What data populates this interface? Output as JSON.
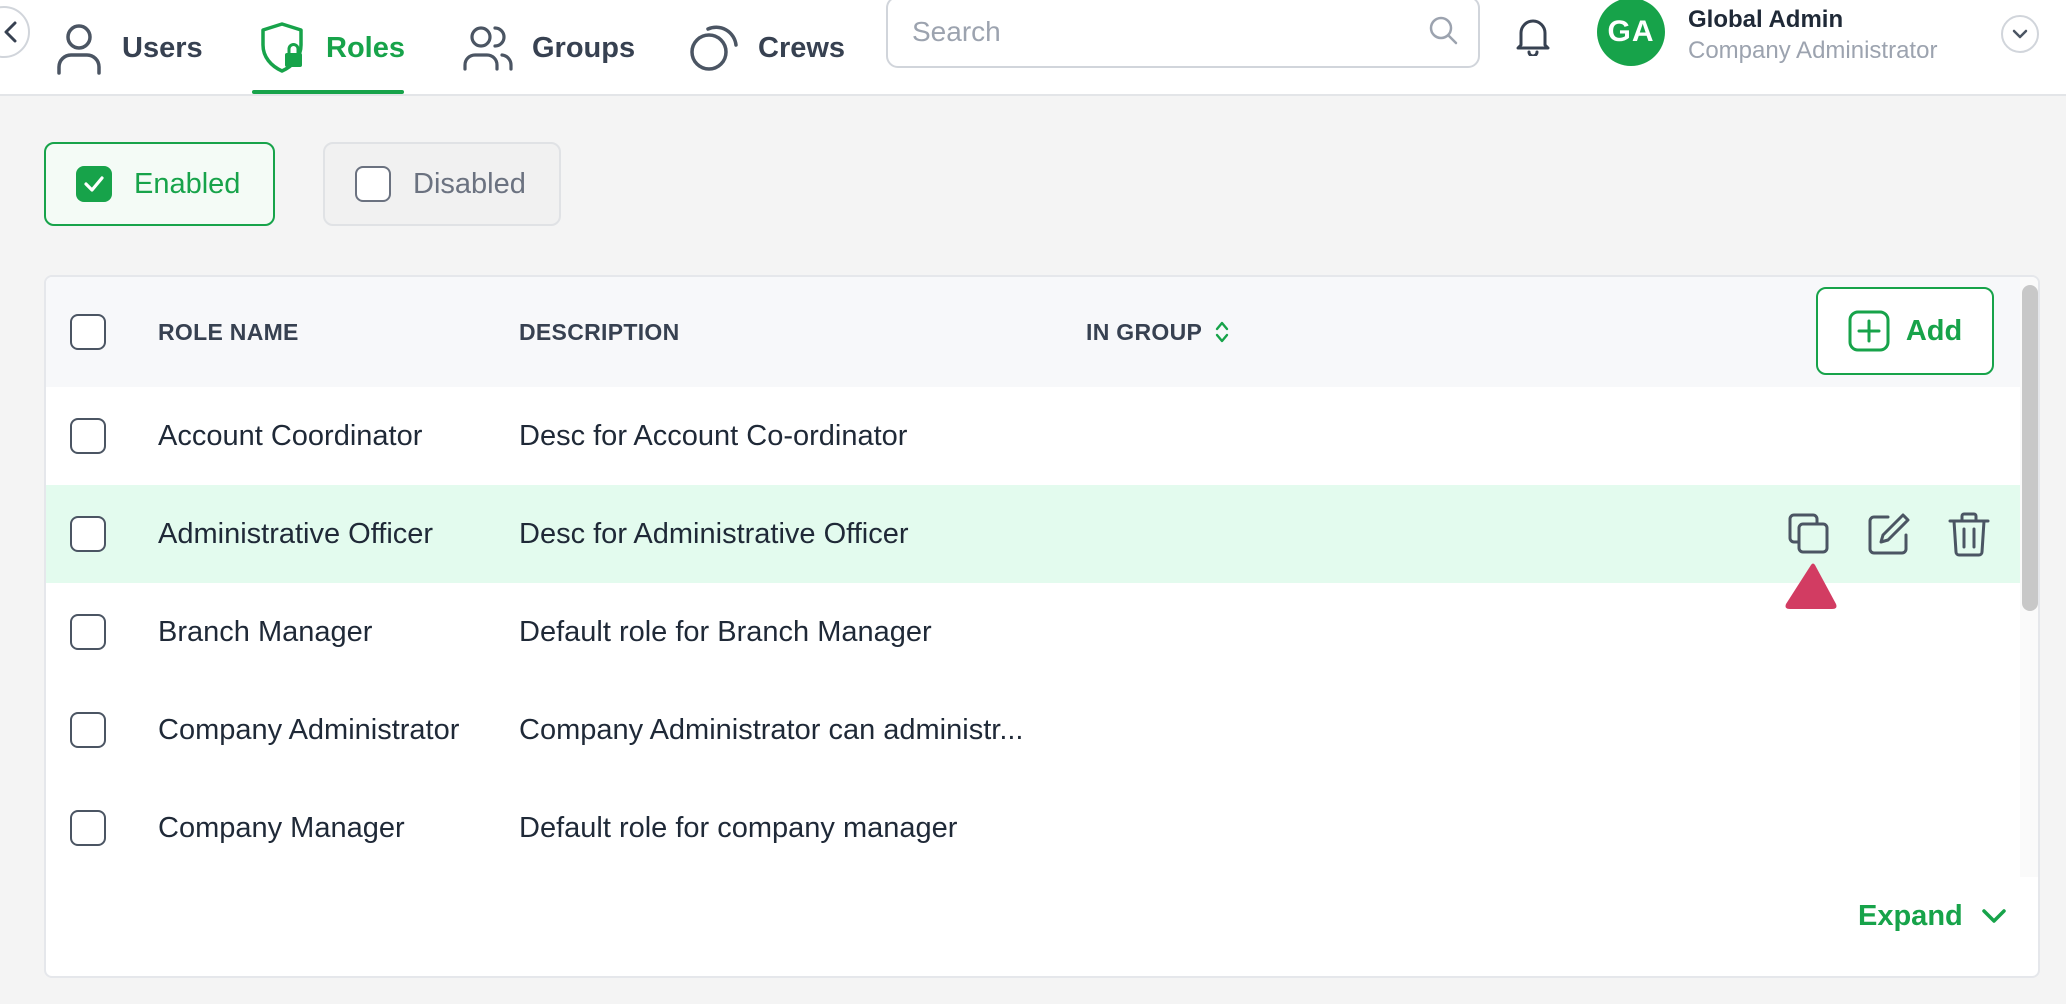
{
  "nav": {
    "tabs": [
      {
        "label": "Users",
        "icon": "user-icon",
        "active": false
      },
      {
        "label": "Roles",
        "icon": "shield-lock-icon",
        "active": true
      },
      {
        "label": "Groups",
        "icon": "users-group-icon",
        "active": false
      },
      {
        "label": "Crews",
        "icon": "crews-icon",
        "active": false
      }
    ],
    "search": {
      "placeholder": "Search",
      "value": ""
    },
    "user": {
      "initials": "GA",
      "name": "Global Admin",
      "role": "Company Administrator"
    }
  },
  "filters": {
    "enabled": {
      "label": "Enabled",
      "checked": true
    },
    "disabled": {
      "label": "Disabled",
      "checked": false
    }
  },
  "table": {
    "columns": {
      "role_name": "ROLE NAME",
      "description": "DESCRIPTION",
      "in_group": "IN GROUP"
    },
    "add_label": "Add",
    "rows": [
      {
        "name": "Account Coordinator",
        "description": "Desc for Account Co-ordinator"
      },
      {
        "name": "Administrative Officer",
        "description": "Desc for Administrative Officer"
      },
      {
        "name": "Branch Manager",
        "description": "Default role for Branch Manager"
      },
      {
        "name": "Company Administrator",
        "description": "Company Administrator can administr..."
      },
      {
        "name": "Company Manager",
        "description": "Default role for company manager"
      }
    ],
    "highlighted_row": 1,
    "expand_label": "Expand"
  },
  "colors": {
    "accent": "#17a34a",
    "highlight_row": "#e3fbee",
    "marker": "#d23c62"
  }
}
